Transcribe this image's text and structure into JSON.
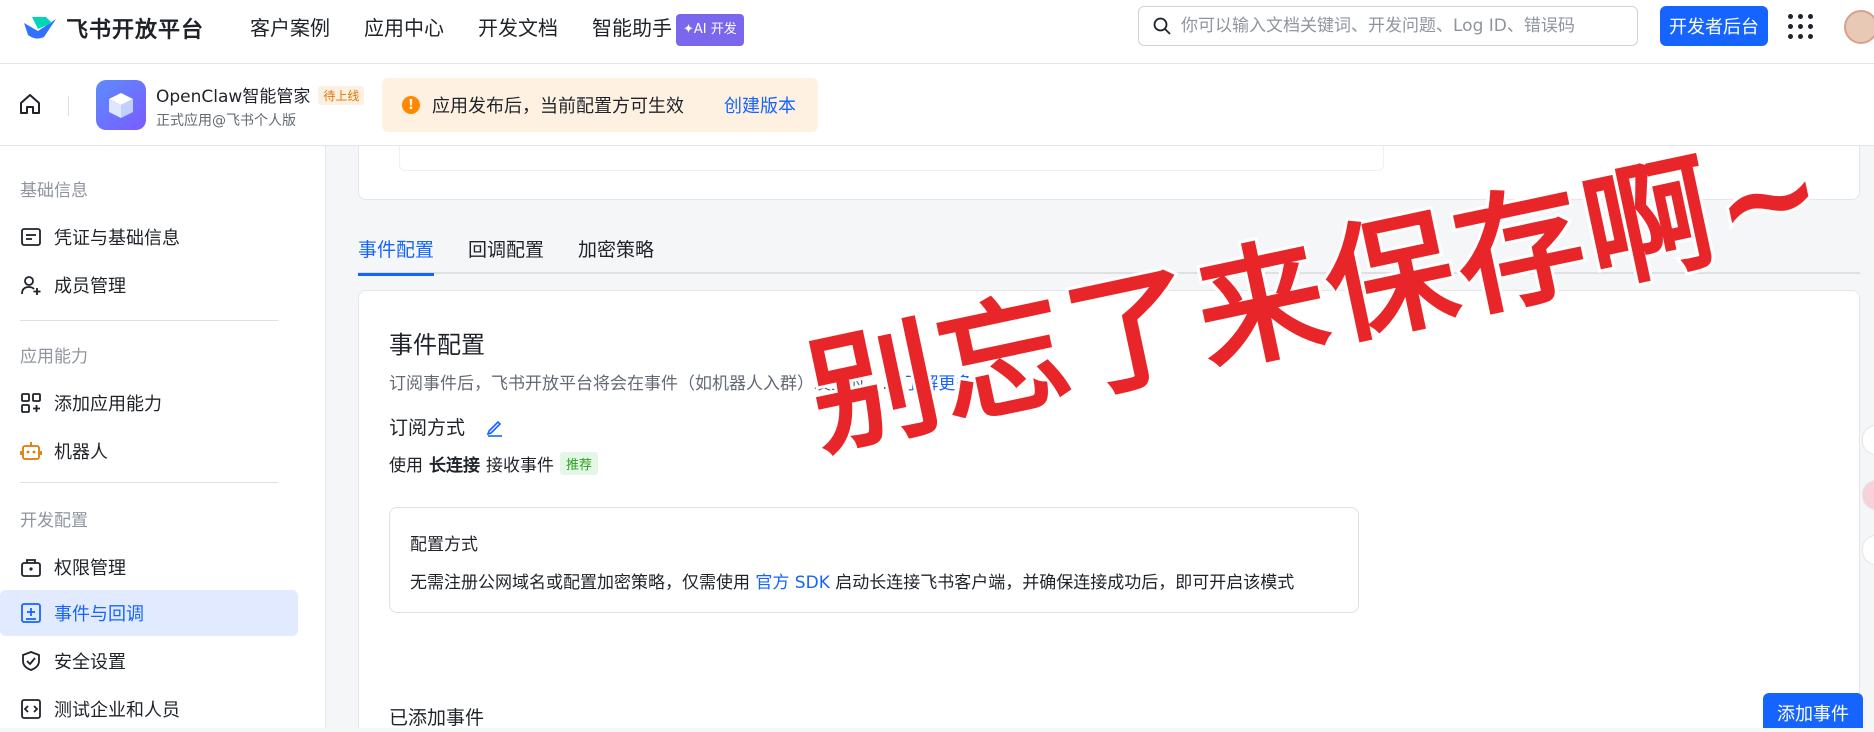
{
  "topbar": {
    "logo_text": "飞书开放平台",
    "nav": [
      "客户案例",
      "应用中心",
      "开发文档",
      "智能助手"
    ],
    "ai_badge": "✦AI 开发",
    "search_placeholder": "你可以输入文档关键词、开发问题、Log ID、错误码",
    "dev_console": "开发者后台"
  },
  "appbar": {
    "app_name": "OpenClaw智能管家",
    "app_status": "待上线",
    "app_sub": "正式应用@飞书个人版",
    "notice_text": "应用发布后，当前配置方可生效",
    "notice_link": "创建版本"
  },
  "sidebar": {
    "sections": [
      {
        "title": "基础信息",
        "items": [
          "凭证与基础信息",
          "成员管理"
        ]
      },
      {
        "title": "应用能力",
        "items": [
          "添加应用能力",
          "机器人"
        ]
      },
      {
        "title": "开发配置",
        "items": [
          "权限管理",
          "事件与回调",
          "安全设置",
          "测试企业和人员"
        ]
      }
    ],
    "active_item": "事件与回调"
  },
  "tabs": [
    "事件配置",
    "回调配置",
    "加密策略"
  ],
  "active_tab": "事件配置",
  "event_card": {
    "title": "事件配置",
    "desc_text": "订阅事件后，飞书开放平台将会在事件（如机器人入群）发生时",
    "desc_link": "了解更多",
    "sub_way_label": "订阅方式",
    "use_prefix": "使用",
    "use_bold": "长连接",
    "use_suffix": "接收事件",
    "recommend_tag": "推荐",
    "config_title": "配置方式",
    "config_desc_1": "无需注册公网域名或配置加密策略，仅需使用",
    "config_link": "官方 SDK",
    "config_desc_2": "启动长连接飞书客户端，并确保连接成功后，即可开启该模式",
    "added_events": "已添加事件",
    "add_event_btn": "添加事件"
  },
  "overlay_text": "别忘了来保存啊~"
}
